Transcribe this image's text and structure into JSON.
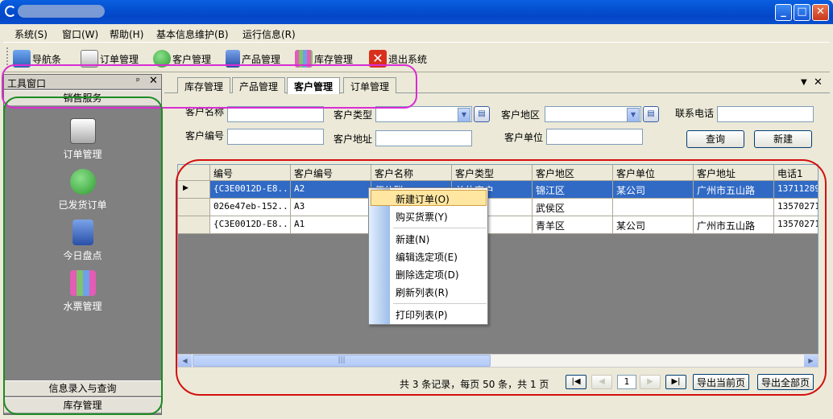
{
  "window": {
    "minimize_glyph": "_",
    "maximize_glyph": "□",
    "close_glyph": "✕"
  },
  "menu": [
    "系统(S)",
    "窗口(W)",
    "帮助(H)",
    "基本信息维护(B)",
    "运行信息(R)"
  ],
  "toolbar": {
    "nav": "导航条",
    "orders": "订单管理",
    "customers": "客户管理",
    "products": "产品管理",
    "inventory": "库存管理",
    "exit": "退出系统"
  },
  "dock": {
    "title": "工具窗口",
    "pin_glyph": "ᵖ",
    "close_glyph": "✕",
    "group_sales": "销售服务",
    "items": [
      "订单管理",
      "已发货订单",
      "今日盘点",
      "水票管理"
    ],
    "group_info": "信息录入与查询",
    "group_inventory": "库存管理"
  },
  "tabs": [
    "库存管理",
    "产品管理",
    "客户管理",
    "订单管理"
  ],
  "active_tab": "客户管理",
  "tab_controls": {
    "dropdown": "▼",
    "close": "✕"
  },
  "form": {
    "customer_name_label": "客户名称",
    "customer_type_label": "客户类型",
    "customer_region_label": "客户地区",
    "phone_label": "联系电话",
    "customer_id_label": "客户编号",
    "address_label": "客户地址",
    "company_label": "客户单位",
    "search_button": "查询",
    "new_button": "新建",
    "dropdown_glyph": "▼",
    "picker_glyph": "▤"
  },
  "grid": {
    "columns": [
      "编号",
      "客户编号",
      "客户名称",
      "客户类型",
      "客户地区",
      "客户单位",
      "客户地址",
      "电话1"
    ],
    "current_row_marker": "▶",
    "rows": [
      [
        "{C3E0012D-E8...",
        "A2",
        "伍伙聪",
        "单位客户",
        "锦江区",
        "某公司",
        "广州市五山路",
        "13711289"
      ],
      [
        "026e47eb-152...",
        "A3",
        "",
        "",
        "武侯区",
        "",
        "",
        "13570271"
      ],
      [
        "{C3E0012D-E8...",
        "A1",
        "",
        "",
        "青羊区",
        "某公司",
        "广州市五山路",
        "13570271"
      ]
    ]
  },
  "scrollbar": {
    "left": "◀",
    "right": "▶",
    "thumb_grip": "|||"
  },
  "pager": {
    "summary": "共 3 条记录，每页 50 条，共 1 页",
    "first": "|◀",
    "prev": "◀",
    "page": "1",
    "next": "▶",
    "last": "▶|",
    "export_current": "导出当前页",
    "export_all": "导出全部页"
  },
  "context_menu": {
    "items": [
      "新建订单(O)",
      "购买货票(Y)",
      "新建(N)",
      "编辑选定项(E)",
      "删除选定项(D)",
      "刷新列表(R)",
      "打印列表(P)"
    ]
  },
  "colors": {
    "titlebar": "#0450D0",
    "selection": "#316AC5",
    "annotation_pink": "#D92CD3",
    "annotation_green": "#1A8C23",
    "annotation_red": "#D40F0F"
  }
}
